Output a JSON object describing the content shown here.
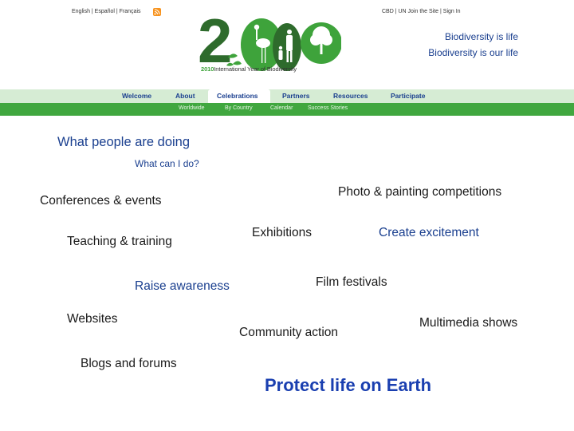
{
  "header": {
    "language_links": "English | Español | Français",
    "top_links": "CBD | UN     Join the Site | Sign In",
    "logo": {
      "text": "2010",
      "caption_prefix": "2010",
      "caption_rest": "International Year of Biodiversity"
    },
    "taglines": [
      "Biodiversity is life",
      "Biodiversity is our life"
    ]
  },
  "nav": {
    "items": [
      "Welcome",
      "About",
      "Celebrations",
      "Partners",
      "Resources",
      "Participate"
    ],
    "active": "Celebrations",
    "sub_items": [
      "Worldwide",
      "By Country",
      "Calendar",
      "Success Stories"
    ]
  },
  "content": {
    "heading": "What people are doing",
    "subheading": "What can I do?",
    "ideas": {
      "photo": "Photo & painting competitions",
      "conferences": "Conferences & events",
      "exhibitions": "Exhibitions",
      "excitement": "Create excitement",
      "teaching": "Teaching & training",
      "film": "Film festivals",
      "awareness": "Raise awareness",
      "websites": "Websites",
      "multimedia": "Multimedia shows",
      "community": "Community action",
      "blogs": "Blogs and forums"
    },
    "final_statement": "Protect life on Earth"
  },
  "colors": {
    "brand_green": "#3ea33b",
    "dark_green": "#2e6b2c",
    "nav_bg": "#d6ecd4",
    "subnav_bg": "#40a73f",
    "text_blue": "#1a3f8f"
  }
}
